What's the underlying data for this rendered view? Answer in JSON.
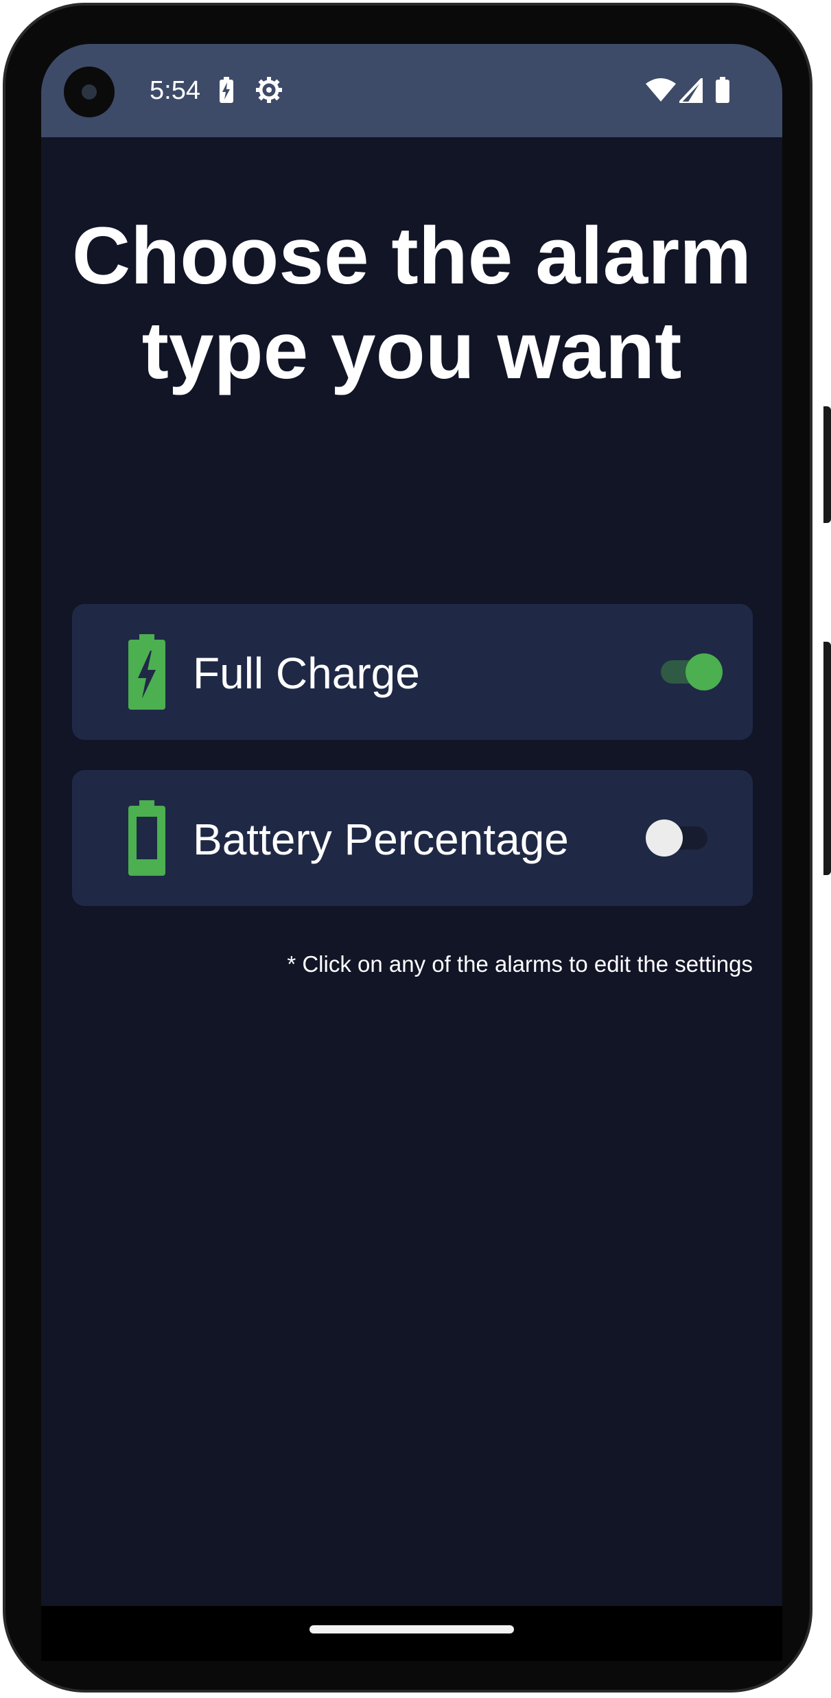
{
  "status_bar": {
    "time": "5:54",
    "icons": [
      "battery-saver-icon",
      "settings-icon",
      "wifi-icon",
      "signal-icon",
      "battery-icon"
    ]
  },
  "headline": {
    "line1": "Choose the alarm",
    "line2": "type you want"
  },
  "alarms": [
    {
      "label": "Full Charge",
      "icon": "battery-charging-icon",
      "enabled": true
    },
    {
      "label": "Battery Percentage",
      "icon": "battery-full-icon",
      "enabled": false
    }
  ],
  "hint": "* Click on any of the alarms to edit the settings",
  "colors": {
    "background": "#111526",
    "status_bar": "#3d4b68",
    "card": "#1f2946",
    "accent_green": "#4caf50",
    "text": "#ffffff"
  }
}
